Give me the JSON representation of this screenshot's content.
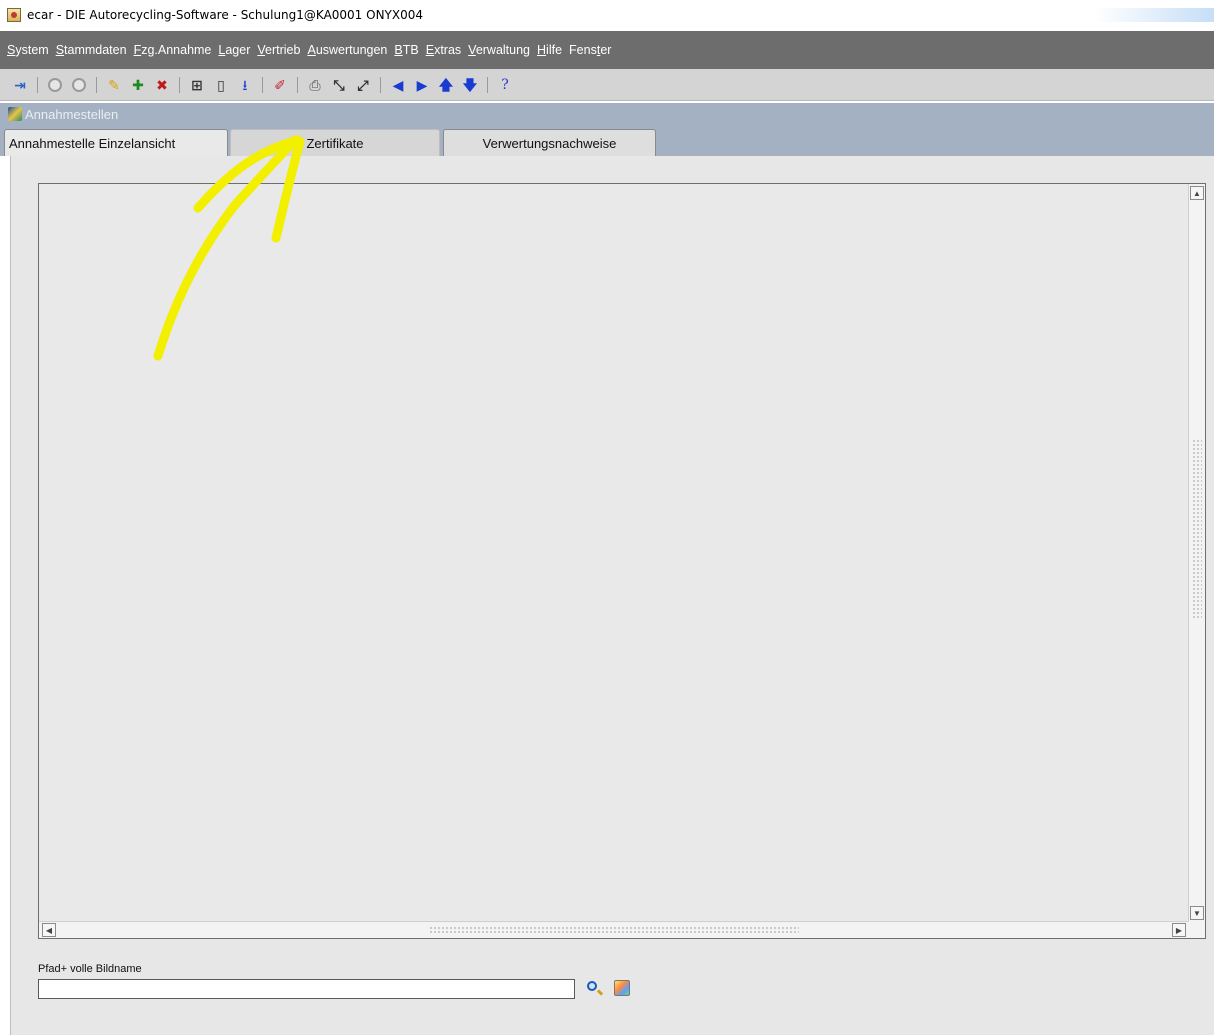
{
  "window": {
    "title": "ecar - DIE Autorecycling-Software - Schulung1@KA0001   ONYX004"
  },
  "menu": [
    {
      "label": "System",
      "accel_index": 0
    },
    {
      "label": "Stammdaten",
      "accel_index": 0
    },
    {
      "label": "Fzg.Annahme",
      "accel_index": 0
    },
    {
      "label": "Lager",
      "accel_index": 0
    },
    {
      "label": "Vertrieb",
      "accel_index": 0
    },
    {
      "label": "Auswertungen",
      "accel_index": 0
    },
    {
      "label": "BTB",
      "accel_index": 0
    },
    {
      "label": "Extras",
      "accel_index": 0
    },
    {
      "label": "Verwaltung",
      "accel_index": 0
    },
    {
      "label": "Hilfe",
      "accel_index": 0
    },
    {
      "label": "Fenster",
      "accel_index": 4
    }
  ],
  "toolbar": {
    "icons": [
      "exit-icon",
      "back-circle-icon",
      "forward-circle-icon",
      "new-record-icon",
      "add-icon",
      "delete-icon",
      "query-icon",
      "clear-icon",
      "save-arrow-icon",
      "edit-icon",
      "print-icon",
      "expand-icon",
      "collapse-icon",
      "prev-icon",
      "next-icon",
      "up-icon",
      "down-icon",
      "help-icon"
    ]
  },
  "form": {
    "title": "Annahmestellen"
  },
  "tabs": [
    {
      "label": "Annahmestelle Einzelansicht"
    },
    {
      "label": "Zertifikate"
    },
    {
      "label": "Verwertungsnachweise"
    }
  ],
  "fields": {
    "path_label": "Pfad+ volle Bildname",
    "path_value": ""
  },
  "colors": {
    "menubar": "#6d6d6d",
    "toolbar": "#d4d4d4",
    "winstrip": "#a3b1c3",
    "annotation": "#f2ef00"
  }
}
